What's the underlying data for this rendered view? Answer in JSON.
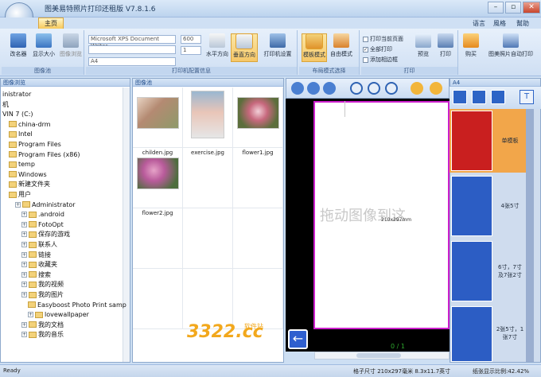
{
  "window": {
    "title": "图美易特照片打印还租版 V7.8.1.6"
  },
  "tab": {
    "main": "主页"
  },
  "menu": {
    "language": "语言",
    "style": "風格",
    "help": "幫助"
  },
  "ribbon": {
    "image_pool": {
      "change_dir": "改名器",
      "show_size": "显示大小",
      "browse": "图像浏览",
      "group": "图像池"
    },
    "print_config": {
      "printer": "Microsoft XPS Document Writer",
      "dpi": "600",
      "copies": "1",
      "paper": "A4",
      "landscape": "水平方向",
      "portrait": "垂直方向",
      "printer_settings": "打印机设置",
      "group": "打印机配置信息"
    },
    "layout": {
      "template_mode": "模板模式",
      "free_mode": "自由模式",
      "group": "布局模式选择"
    },
    "print": {
      "print_current": "打印当前页面",
      "print_all": "全部打印",
      "add_border": "添加相边框",
      "preview": "预览",
      "print": "打印",
      "group": "打印"
    },
    "buy": "购买",
    "auto_print": "图美照片自动打印"
  },
  "tree": {
    "header": "图像浏览",
    "items": [
      "inistrator",
      "机",
      "VIN 7 (C:)",
      "china-drm",
      "Intel",
      "Program Files",
      "Program Files (x86)",
      "temp",
      "Windows",
      "新建文件夹",
      "用户",
      "Administrator",
      ".android",
      "FotoOpt",
      "保存的游戏",
      "联系人",
      "链接",
      "收藏夹",
      "搜索",
      "我的视频",
      "我的图片",
      "Easyboost Photo Print samp",
      "lovewallpaper",
      "我的文档",
      "我的音乐"
    ]
  },
  "thumbs": {
    "header": "图像池",
    "files": [
      "childen.jpg",
      "exercise.jpg",
      "flower1.jpg",
      "flower2.jpg"
    ]
  },
  "preview": {
    "drag_text": "拖动图像到这",
    "page_size": "210x297mm",
    "page_num": "0 / 1"
  },
  "templates": {
    "header": "A4",
    "items": [
      "单模板",
      "4张5寸",
      "6寸，7寸\n及7张2寸",
      "2张5寸，1\n张7寸"
    ]
  },
  "status": {
    "left": "Ready",
    "size": "格子尺寸 210x297毫米  8.3x11.7英寸",
    "ratio": "纸张显示比例:42.42%"
  },
  "watermark": {
    "main": "3322.cc",
    "sub": "软件站"
  }
}
